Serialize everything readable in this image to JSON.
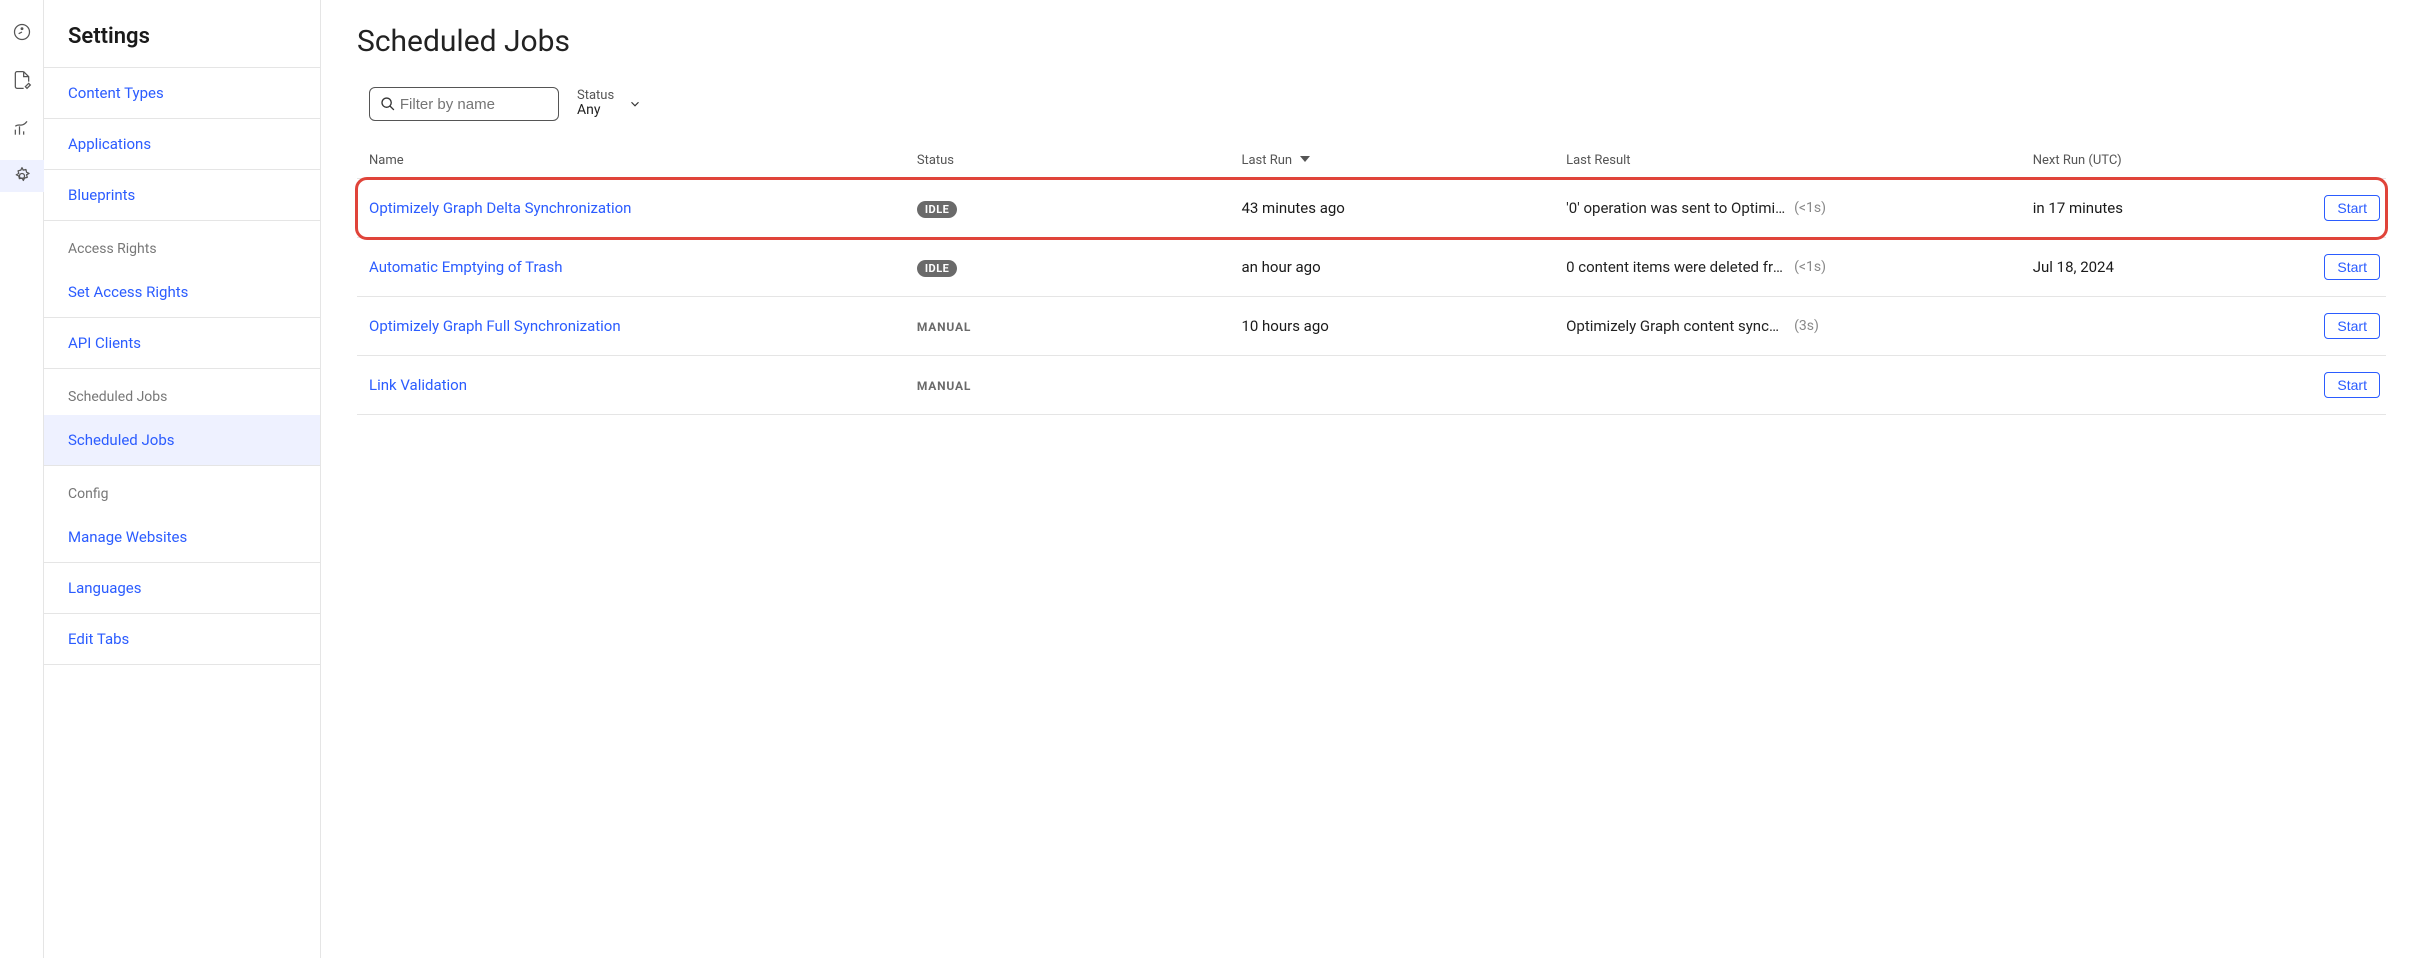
{
  "sidebar": {
    "title": "Settings",
    "items": [
      {
        "section": null,
        "label": "Content Types",
        "active": false
      },
      {
        "section": null,
        "label": "Applications",
        "active": false
      },
      {
        "section": null,
        "label": "Blueprints",
        "active": false
      }
    ],
    "groups": [
      {
        "heading": "Access Rights",
        "items": [
          {
            "label": "Set Access Rights",
            "active": false
          },
          {
            "label": "API Clients",
            "active": false
          }
        ]
      },
      {
        "heading": "Scheduled Jobs",
        "items": [
          {
            "label": "Scheduled Jobs",
            "active": true
          }
        ]
      },
      {
        "heading": "Config",
        "items": [
          {
            "label": "Manage Websites",
            "active": false
          },
          {
            "label": "Languages",
            "active": false
          },
          {
            "label": "Edit Tabs",
            "active": false
          }
        ]
      }
    ]
  },
  "page": {
    "title": "Scheduled Jobs",
    "filter": {
      "placeholder": "Filter by name",
      "value": ""
    },
    "statusFilter": {
      "label": "Status",
      "value": "Any"
    },
    "table": {
      "columns": {
        "name": "Name",
        "status": "Status",
        "lastRun": "Last Run",
        "lastResult": "Last Result",
        "nextRun": "Next Run (UTC)"
      },
      "sortColumn": "lastRun",
      "sortDir": "desc",
      "startLabel": "Start",
      "rows": [
        {
          "name": "Optimizely Graph Delta Synchronization",
          "status": "IDLE",
          "statusKind": "idle",
          "lastRun": "43 minutes ago",
          "result": "'0' operation was sent to Optimiz…",
          "duration": "(<1s)",
          "nextRun": "in 17 minutes",
          "highlighted": true
        },
        {
          "name": "Automatic Emptying of Trash",
          "status": "IDLE",
          "statusKind": "idle",
          "lastRun": "an hour ago",
          "result": "0 content items were deleted fro…",
          "duration": "(<1s)",
          "nextRun": "Jul 18, 2024",
          "highlighted": false
        },
        {
          "name": "Optimizely Graph Full Synchronization",
          "status": "MANUAL",
          "statusKind": "manual",
          "lastRun": "10 hours ago",
          "result": "Optimizely Graph content synchro…",
          "duration": "(3s)",
          "nextRun": "",
          "highlighted": false
        },
        {
          "name": "Link Validation",
          "status": "MANUAL",
          "statusKind": "manual",
          "lastRun": "",
          "result": "",
          "duration": "",
          "nextRun": "",
          "highlighted": false
        }
      ]
    }
  }
}
